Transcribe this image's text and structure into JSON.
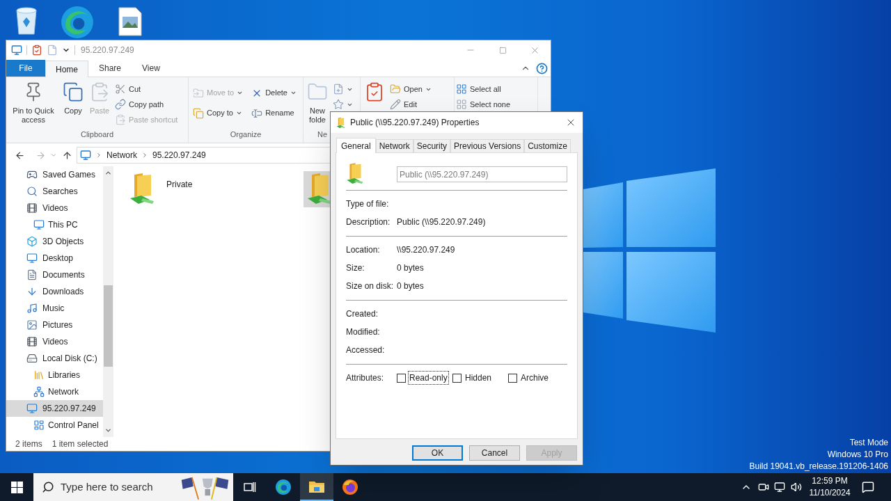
{
  "explorer": {
    "title": "95.220.97.249",
    "ribbon_tabs": [
      {
        "label": "File",
        "kind": "file",
        "selected": false
      },
      {
        "label": "Home",
        "kind": "tab",
        "selected": true
      },
      {
        "label": "Share",
        "kind": "tab",
        "selected": false
      },
      {
        "label": "View",
        "kind": "tab",
        "selected": false
      }
    ],
    "ribbon_groups": [
      {
        "label": "Clipboard",
        "columns": [
          {
            "kind": "large",
            "items": [
              {
                "kind": "pin",
                "label": "Pin to Quick access",
                "disabled": false,
                "dropdown": false
              },
              {
                "kind": "copy",
                "label": "Copy",
                "disabled": false,
                "dropdown": false
              },
              {
                "kind": "paste",
                "label": "Paste",
                "disabled": true,
                "dropdown": false
              }
            ]
          },
          {
            "kind": "small",
            "items": [
              {
                "kind": "cut",
                "label": "Cut",
                "disabled": false,
                "dropdown": false
              },
              {
                "kind": "copy_path",
                "label": "Copy path",
                "disabled": false,
                "dropdown": false
              },
              {
                "kind": "paste_shortcut",
                "label": "Paste shortcut",
                "disabled": true,
                "dropdown": false
              }
            ]
          }
        ]
      },
      {
        "label": "Organize",
        "columns": [
          {
            "kind": "medium",
            "items": [
              {
                "kind": "move_to",
                "label": "Move to",
                "disabled": true,
                "dropdown": true
              },
              {
                "kind": "copy_to",
                "label": "Copy to",
                "disabled": false,
                "dropdown": true
              }
            ]
          },
          {
            "kind": "medium",
            "items": [
              {
                "kind": "delete",
                "label": "Delete",
                "disabled": false,
                "dropdown": true
              },
              {
                "kind": "rename",
                "label": "Rename",
                "disabled": false,
                "dropdown": false
              }
            ]
          }
        ]
      },
      {
        "label": "Ne",
        "columns": [
          {
            "kind": "large",
            "items": [
              {
                "kind": "new_folder",
                "label": "New folde",
                "disabled": false,
                "dropdown": false
              }
            ]
          },
          {
            "kind": "small",
            "items": [
              {
                "kind": "new_item",
                "disabled": false,
                "dropdown": true
              },
              {
                "kind": "easy_access",
                "disabled": false,
                "dropdown": true
              }
            ]
          }
        ]
      },
      {
        "columns": [
          {
            "kind": "large",
            "items": [
              {
                "kind": "properties",
                "disabled": false,
                "dropdown": false
              }
            ]
          },
          {
            "kind": "small",
            "items": [
              {
                "kind": "open",
                "label": "Open",
                "disabled": false,
                "dropdown": true
              },
              {
                "kind": "edit",
                "label": "Edit",
                "disabled": false,
                "dropdown": false
              }
            ]
          }
        ]
      },
      {
        "columns": [
          {
            "kind": "small",
            "items": [
              {
                "kind": "select_all",
                "label": "Select all",
                "disabled": false,
                "dropdown": false
              },
              {
                "kind": "select_none",
                "label": "Select none",
                "disabled": false,
                "dropdown": false
              }
            ]
          }
        ]
      }
    ],
    "address": {
      "crumbs": [
        "Network",
        "95.220.97.249"
      ]
    },
    "nav_items": [
      {
        "children": [
          {
            "label": "Saved Games",
            "kind": "saved_games",
            "selected": false
          },
          {
            "label": "Searches",
            "kind": "searches",
            "selected": false
          },
          {
            "label": "Videos",
            "kind": "videos",
            "selected": false
          }
        ]
      },
      {
        "label": "This PC",
        "kind": "pc",
        "selected": false,
        "children": [
          {
            "label": "3D Objects",
            "kind": "objects3d",
            "selected": false
          },
          {
            "label": "Desktop",
            "kind": "desktop",
            "selected": false
          },
          {
            "label": "Documents",
            "kind": "documents",
            "selected": false
          },
          {
            "label": "Downloads",
            "kind": "downloads",
            "selected": false
          },
          {
            "label": "Music",
            "kind": "music",
            "selected": false
          },
          {
            "label": "Pictures",
            "kind": "pictures",
            "selected": false
          },
          {
            "label": "Videos",
            "kind": "videos",
            "selected": false
          },
          {
            "label": "Local Disk (C:)",
            "kind": "disk",
            "selected": false
          }
        ]
      },
      {
        "label": "Libraries",
        "kind": "libraries",
        "selected": false
      },
      {
        "label": "Network",
        "kind": "network",
        "selected": false,
        "children": [
          {
            "label": "95.220.97.249",
            "kind": "pc",
            "selected": true
          }
        ]
      },
      {
        "label": "Control Panel",
        "kind": "control_panel",
        "selected": false
      }
    ],
    "content_items": [
      {
        "label": "Private",
        "selected": false
      },
      {
        "selected": true
      }
    ],
    "status": {
      "item_count": "2 items",
      "selection": "1 item selected"
    }
  },
  "dialog": {
    "title": "Public (\\\\95.220.97.249) Properties",
    "tabs": [
      {
        "label": "General",
        "selected": true
      },
      {
        "label": "Network",
        "selected": false
      },
      {
        "label": "Security",
        "selected": false
      },
      {
        "label": "Previous Versions",
        "selected": false
      },
      {
        "label": "Customize",
        "selected": false
      }
    ],
    "name_field": {
      "value": "Public (\\\\95.220.97.249)",
      "disabled": true
    },
    "sections": [
      [
        {
          "label": "Type of file:"
        },
        {
          "label": "Description:",
          "value": "Public (\\\\95.220.97.249)"
        }
      ],
      [
        {
          "label": "Location:",
          "value": "\\\\95.220.97.249"
        },
        {
          "label": "Size:",
          "value": "0 bytes"
        },
        {
          "label": "Size on disk:",
          "value": "0 bytes"
        }
      ],
      [
        {
          "label": "Created:"
        },
        {
          "label": "Modified:"
        },
        {
          "label": "Accessed:"
        }
      ]
    ],
    "attributes": {
      "label": "Attributes:",
      "checks": [
        {
          "label": "Read-only",
          "checked": false,
          "focused": true
        },
        {
          "label": "Hidden",
          "checked": false,
          "focused": false
        },
        {
          "label": "Archive",
          "checked": false,
          "focused": false
        }
      ]
    },
    "buttons": [
      {
        "label": "OK",
        "default": true,
        "disabled": false
      },
      {
        "label": "Cancel",
        "default": false,
        "disabled": false
      },
      {
        "label": "Apply",
        "default": false,
        "disabled": true
      }
    ]
  },
  "desktop": {
    "watermark": [
      "Test Mode",
      "Windows 10 Pro",
      "Build 19041.vb_release.191206-1406"
    ]
  },
  "taskbar": {
    "search_placeholder": "Type here to search",
    "apps": [
      {
        "kind": "task_view",
        "selected": false
      },
      {
        "kind": "edge",
        "selected": false
      },
      {
        "kind": "file_explorer",
        "selected": true
      },
      {
        "kind": "firefox",
        "selected": false
      }
    ],
    "time": "12:59 PM",
    "date": "11/10/2024"
  }
}
